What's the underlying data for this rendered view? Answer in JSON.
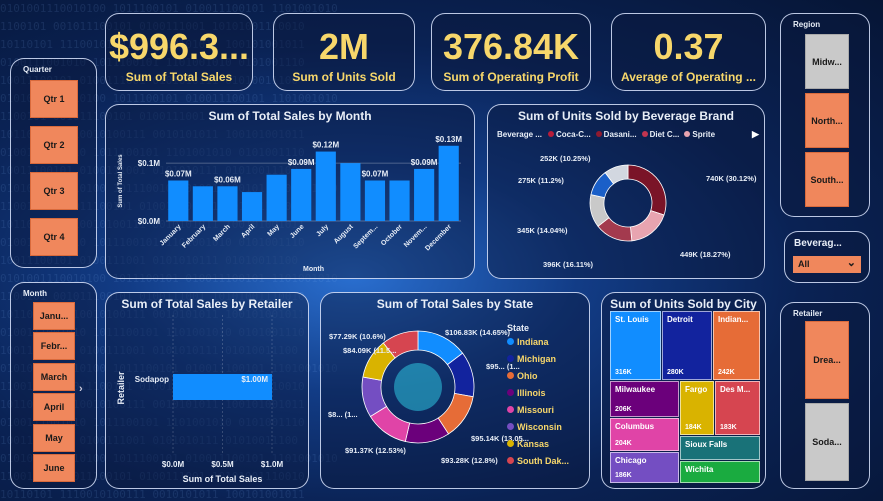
{
  "kpis": [
    {
      "value": "$996.3...",
      "label": "Sum of Total Sales"
    },
    {
      "value": "2M",
      "label": "Sum of Units Sold"
    },
    {
      "value": "376.84K",
      "label": "Sum of Operating Profit"
    },
    {
      "value": "0.37",
      "label": "Average of Operating ..."
    }
  ],
  "slicers": {
    "quarter": {
      "title": "Quarter",
      "items": [
        "Qtr 1",
        "Qtr 2",
        "Qtr 3",
        "Qtr 4"
      ]
    },
    "month": {
      "title": "Month",
      "items": [
        "Janu...",
        "Febr...",
        "March",
        "April",
        "May",
        "June"
      ]
    },
    "region": {
      "title": "Region",
      "items": [
        "Midw...",
        "North...",
        "South..."
      ]
    },
    "beverage": {
      "title": "Beverag...",
      "value": "All"
    },
    "retailer": {
      "title": "Retailer",
      "items": [
        "Drea...",
        "Soda..."
      ]
    }
  },
  "colors": {
    "accent": "#f7d76b",
    "bar": "#118dff",
    "tile": "#f0875c"
  },
  "chart_data": [
    {
      "type": "bar",
      "title": "Sum of Total Sales by Month",
      "ylabel": "Sum of Total Sales",
      "xlabel": "Month",
      "yticks": [
        "$0.0M",
        "$0.1M"
      ],
      "ylim": [
        0,
        0.14
      ],
      "categories": [
        "January",
        "February",
        "March",
        "April",
        "May",
        "June",
        "July",
        "August",
        "Septem...",
        "October",
        "Novem...",
        "December"
      ],
      "values": [
        0.07,
        0.06,
        0.06,
        0.05,
        0.08,
        0.09,
        0.12,
        0.1,
        0.07,
        0.07,
        0.09,
        0.13
      ],
      "data_labels": [
        "$0.07M",
        "",
        "$0.06M",
        "",
        "",
        "$0.09M",
        "$0.12M",
        "",
        "$0.07M",
        "",
        "$0.09M",
        "$0.13M"
      ]
    },
    {
      "type": "pie",
      "title": "Sum of Units Sold by Beverage Brand",
      "legend_title": "Beverage ...",
      "legend": [
        {
          "name": "Coca-C...",
          "color": "#b71c3a"
        },
        {
          "name": "Dasani...",
          "color": "#8e1a30"
        },
        {
          "name": "Diet C...",
          "color": "#c23550"
        },
        {
          "name": "Sprite",
          "color": "#e8a4b0"
        }
      ],
      "slices": [
        {
          "label": "740K (30.12%)",
          "value": 740,
          "color": "#7a1428"
        },
        {
          "label": "449K (18.27%)",
          "value": 449,
          "color": "#e8a4b0"
        },
        {
          "label": "396K (16.11%)",
          "value": 396,
          "color": "#a33a4e"
        },
        {
          "label": "345K (14.04%)",
          "value": 345,
          "color": "#c9c9c9"
        },
        {
          "label": "275K (11.2%)",
          "value": 275,
          "color": "#1a5fc8"
        },
        {
          "label": "252K (10.25%)",
          "value": 252,
          "color": "#d2d7e0"
        }
      ]
    },
    {
      "type": "bar",
      "title": "Sum of Total Sales by Retailer",
      "ylabel": "Retailer",
      "xlabel": "Sum of Total Sales",
      "categories": [
        "Sodapop"
      ],
      "values": [
        1.0
      ],
      "data_labels": [
        "$1.00M"
      ],
      "xticks": [
        "$0.0M",
        "$0.5M",
        "$1.0M"
      ],
      "xlim": [
        0,
        1.0
      ]
    },
    {
      "type": "pie",
      "title": "Sum of Total Sales by State",
      "legend_title": "State",
      "legend": [
        {
          "name": "Indiana",
          "color": "#118dff"
        },
        {
          "name": "Michigan",
          "color": "#12239e"
        },
        {
          "name": "Ohio",
          "color": "#e66c37"
        },
        {
          "name": "Illinois",
          "color": "#6b007b"
        },
        {
          "name": "Missouri",
          "color": "#e044a7"
        },
        {
          "name": "Wisconsin",
          "color": "#744ec2"
        },
        {
          "name": "Kansas",
          "color": "#d9b300"
        },
        {
          "name": "South Dak...",
          "color": "#d64550"
        }
      ],
      "slices": [
        {
          "label": "$106.83K (14.65%)",
          "value": 106.83,
          "color": "#118dff"
        },
        {
          "label": "$95... (1...",
          "value": 95.5,
          "color": "#12239e"
        },
        {
          "label": "$95.14K (13.05...",
          "value": 95.14,
          "color": "#e66c37"
        },
        {
          "label": "$93.28K (12.8%)",
          "value": 93.28,
          "color": "#6b007b"
        },
        {
          "label": "$91.37K (12.53%)",
          "value": 91.37,
          "color": "#e044a7"
        },
        {
          "label": "$8... (1...",
          "value": 85.0,
          "color": "#744ec2"
        },
        {
          "label": "$84.09K (11.5...",
          "value": 84.09,
          "color": "#d9b300"
        },
        {
          "label": "$77.29K (10.6%)",
          "value": 77.29,
          "color": "#d64550"
        }
      ]
    },
    {
      "type": "treemap",
      "title": "Sum of Units Sold by City",
      "cells": [
        {
          "name": "St. Louis",
          "value": "316K",
          "color": "#118dff"
        },
        {
          "name": "Detroit",
          "value": "280K",
          "color": "#12239e"
        },
        {
          "name": "Indian...",
          "value": "242K",
          "color": "#e66c37"
        },
        {
          "name": "Milwaukee",
          "value": "206K",
          "color": "#6b007b"
        },
        {
          "name": "Fargo",
          "value": "184K",
          "color": "#d9b300"
        },
        {
          "name": "Des M...",
          "value": "183K",
          "color": "#d64550"
        },
        {
          "name": "Columbus",
          "value": "204K",
          "color": "#e044a7"
        },
        {
          "name": "Sioux Falls",
          "value": "",
          "color": "#197278"
        },
        {
          "name": "Chicago",
          "value": "186K",
          "color": "#744ec2"
        },
        {
          "name": "Wichita",
          "value": "",
          "color": "#1aab40"
        }
      ]
    }
  ]
}
